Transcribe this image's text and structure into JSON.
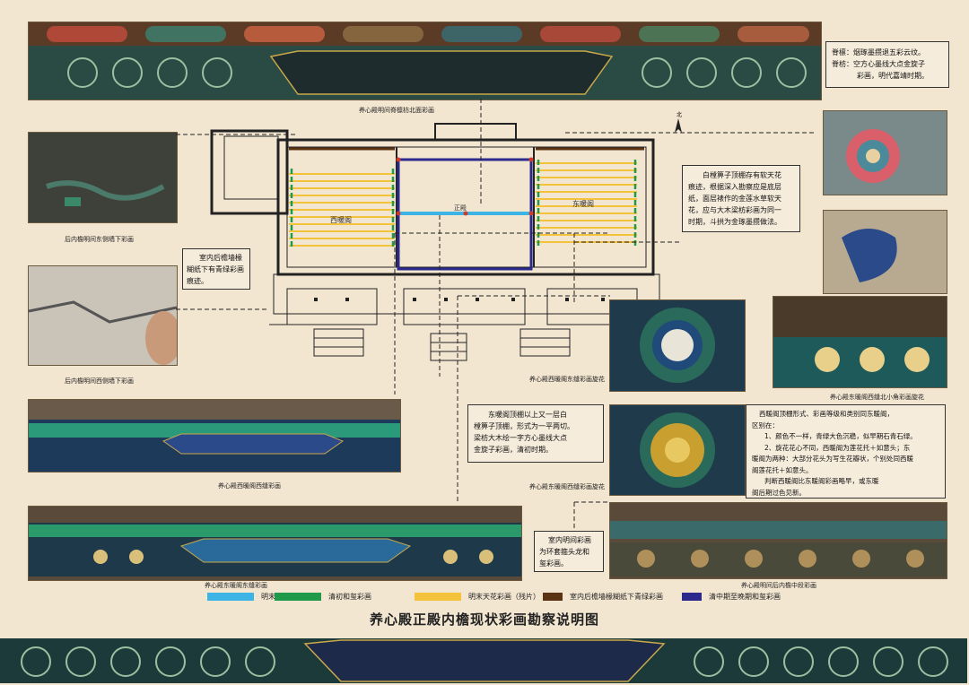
{
  "title": "养心殿正殿内檐现状彩画勘察说明图",
  "captions": {
    "top_photo": "养心殿明间脊檩枋北面彩画",
    "left_photo_1": "后内檐明间东侧墙下彩画",
    "left_photo_2": "后内檐明间西侧墙下彩画",
    "mid_photo_1": "养心殿西暖阁东缝彩画旋花",
    "right_photo_2": "养心殿东暖阁西缝北小角彩画旋花",
    "left_photo_3": "养心殿西暖阁西缝彩画",
    "mid_photo_2": "养心殿东暖阁西缝彩画旋花",
    "bottom_left_photo": "养心殿东暖阁东缝彩画",
    "bottom_right_photo": "养心殿明间后内檐中段彩画"
  },
  "notes": {
    "ridge": [
      "脊檩：烟琢墨攒退五彩云纹。",
      "脊枋：空方心墨线大点金旋子",
      "彩画，明代嘉靖时期。"
    ],
    "right_ceiling": [
      "白樘箅子顶棚存有软天花",
      "痕迹，根据深入勘察应是底层",
      "纸，面层裱作的金莲水草软天",
      "花，应与大木梁枋彩画为同一",
      "时期，斗拱为金琢墨攒做法。"
    ],
    "left_wall": [
      "室内后檐墙椽",
      "糊纸下有青绿彩画",
      "痕迹。"
    ],
    "center_east": [
      "东暖阁顶棚以上又一层白",
      "樘箅子顶棚，形式为一平两切。",
      "梁枋大木绘一字方心墨线大点",
      "金旋子彩画，清初时期。"
    ],
    "right_compare": [
      "西暖阁顶棚形式、彩画等级和类别同东暖阁，",
      "区别在：",
      "1、颜色不一样，青绿大色沉稳，似早期石青石绿。",
      "2、旋花花心不同，西暖阁为莲花托＋如意头；东",
      "暖阁为两种：大部分花头为写生花瓣状，个别处同西暖",
      "阁莲花托＋如意头。",
      "判断西暖阁比东暖阁彩画略早，或东暖",
      "阁后期过色见新。"
    ],
    "bottom_center": [
      "室内明间彩画",
      "为环套箍头龙和",
      "玺彩画。"
    ]
  },
  "plan_labels": {
    "west": "西暖阁",
    "center": "正殿",
    "east": "东暖阁",
    "north": "北"
  },
  "legend": [
    {
      "label": "明末旋子彩画",
      "color": "#3cb4e6"
    },
    {
      "label": "清初和玺彩画",
      "color": "#1e9a4a"
    },
    {
      "label": "明末天花彩画（残片）",
      "color": "#f5c33b"
    },
    {
      "label": "室内后檐墙椽糊纸下青绿彩画",
      "color": "#5a3412"
    },
    {
      "label": "清中期至晚期和玺彩画",
      "color": "#2b2a8c"
    }
  ]
}
